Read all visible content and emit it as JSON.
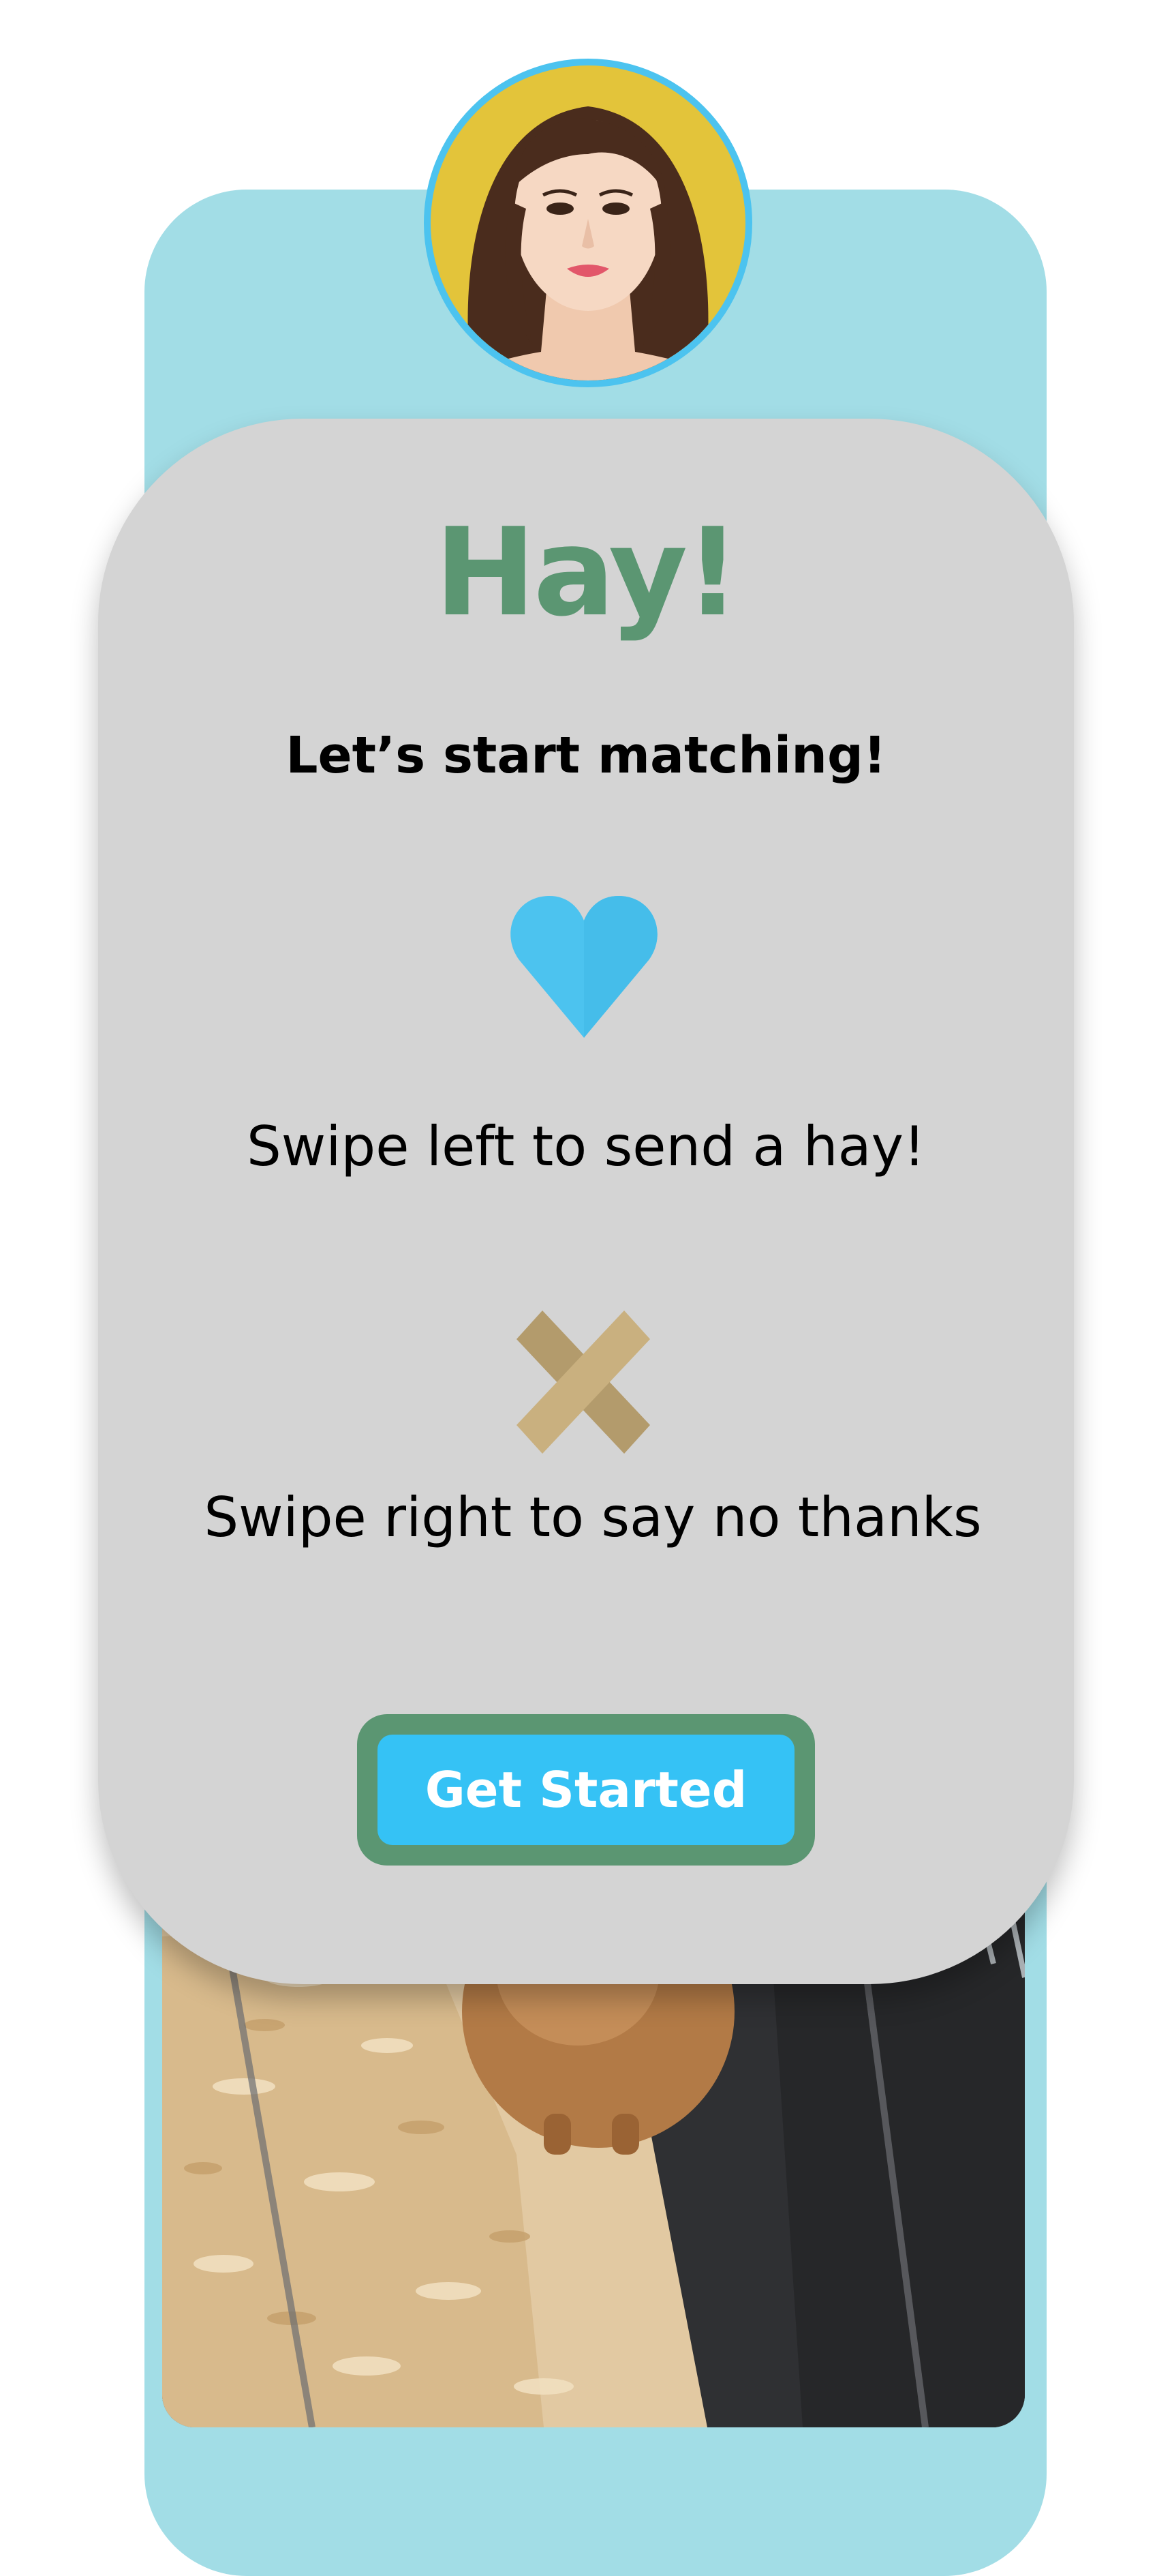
{
  "colors": {
    "teal_panel": "#a2dde6",
    "card": "#d4d4d4",
    "title_green": "#5b9672",
    "accent_blue": "#35c2f5",
    "heart_blue": "#4cc3ef",
    "x_tan": "#c2a875"
  },
  "profile": {
    "avatar_icon": "woman-portrait-photo"
  },
  "onboarding": {
    "title": "Hay!",
    "subtitle": "Let’s start matching!",
    "like_icon": "heart-icon",
    "like_instruction": "Swipe left to send a hay!",
    "pass_icon": "x-icon",
    "pass_instruction": "Swipe right to say no thanks",
    "cta_label": "Get Started"
  },
  "background_card": {
    "photo": "guinea-pig-in-cage-photo"
  }
}
